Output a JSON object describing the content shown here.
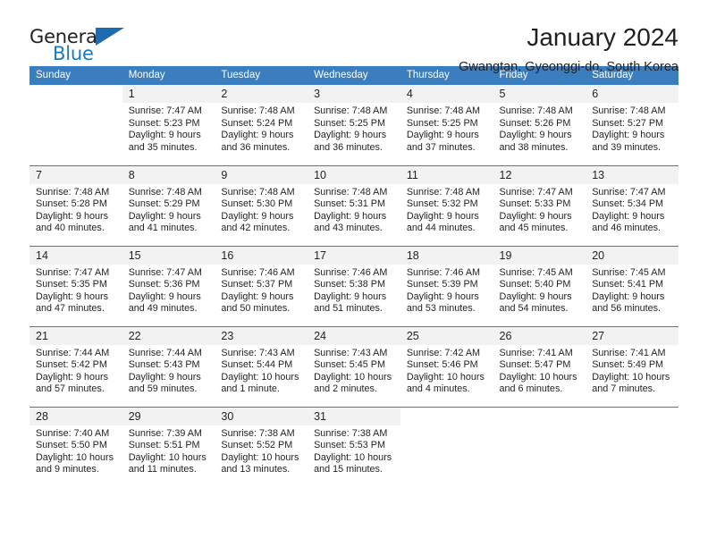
{
  "brand": {
    "name_part1": "General",
    "name_part2": "Blue",
    "logo_icon": "triangle-logo-icon",
    "accent_color": "#1b6cb0"
  },
  "header": {
    "title": "January 2024",
    "subtitle": "Gwangtan, Gyeonggi-do, South Korea"
  },
  "calendar": {
    "header_background": "#3a7ebf",
    "daynum_background": "#f2f2f2",
    "weekday_headers": [
      "Sunday",
      "Monday",
      "Tuesday",
      "Wednesday",
      "Thursday",
      "Friday",
      "Saturday"
    ],
    "weeks": [
      [
        {
          "day": "",
          "sunrise": "",
          "sunset": "",
          "daylight_line1": "",
          "daylight_line2": "",
          "blank": true
        },
        {
          "day": "1",
          "sunrise": "Sunrise: 7:47 AM",
          "sunset": "Sunset: 5:23 PM",
          "daylight_line1": "Daylight: 9 hours",
          "daylight_line2": "and 35 minutes."
        },
        {
          "day": "2",
          "sunrise": "Sunrise: 7:48 AM",
          "sunset": "Sunset: 5:24 PM",
          "daylight_line1": "Daylight: 9 hours",
          "daylight_line2": "and 36 minutes."
        },
        {
          "day": "3",
          "sunrise": "Sunrise: 7:48 AM",
          "sunset": "Sunset: 5:25 PM",
          "daylight_line1": "Daylight: 9 hours",
          "daylight_line2": "and 36 minutes."
        },
        {
          "day": "4",
          "sunrise": "Sunrise: 7:48 AM",
          "sunset": "Sunset: 5:25 PM",
          "daylight_line1": "Daylight: 9 hours",
          "daylight_line2": "and 37 minutes."
        },
        {
          "day": "5",
          "sunrise": "Sunrise: 7:48 AM",
          "sunset": "Sunset: 5:26 PM",
          "daylight_line1": "Daylight: 9 hours",
          "daylight_line2": "and 38 minutes."
        },
        {
          "day": "6",
          "sunrise": "Sunrise: 7:48 AM",
          "sunset": "Sunset: 5:27 PM",
          "daylight_line1": "Daylight: 9 hours",
          "daylight_line2": "and 39 minutes."
        }
      ],
      [
        {
          "day": "7",
          "sunrise": "Sunrise: 7:48 AM",
          "sunset": "Sunset: 5:28 PM",
          "daylight_line1": "Daylight: 9 hours",
          "daylight_line2": "and 40 minutes."
        },
        {
          "day": "8",
          "sunrise": "Sunrise: 7:48 AM",
          "sunset": "Sunset: 5:29 PM",
          "daylight_line1": "Daylight: 9 hours",
          "daylight_line2": "and 41 minutes."
        },
        {
          "day": "9",
          "sunrise": "Sunrise: 7:48 AM",
          "sunset": "Sunset: 5:30 PM",
          "daylight_line1": "Daylight: 9 hours",
          "daylight_line2": "and 42 minutes."
        },
        {
          "day": "10",
          "sunrise": "Sunrise: 7:48 AM",
          "sunset": "Sunset: 5:31 PM",
          "daylight_line1": "Daylight: 9 hours",
          "daylight_line2": "and 43 minutes."
        },
        {
          "day": "11",
          "sunrise": "Sunrise: 7:48 AM",
          "sunset": "Sunset: 5:32 PM",
          "daylight_line1": "Daylight: 9 hours",
          "daylight_line2": "and 44 minutes."
        },
        {
          "day": "12",
          "sunrise": "Sunrise: 7:47 AM",
          "sunset": "Sunset: 5:33 PM",
          "daylight_line1": "Daylight: 9 hours",
          "daylight_line2": "and 45 minutes."
        },
        {
          "day": "13",
          "sunrise": "Sunrise: 7:47 AM",
          "sunset": "Sunset: 5:34 PM",
          "daylight_line1": "Daylight: 9 hours",
          "daylight_line2": "and 46 minutes."
        }
      ],
      [
        {
          "day": "14",
          "sunrise": "Sunrise: 7:47 AM",
          "sunset": "Sunset: 5:35 PM",
          "daylight_line1": "Daylight: 9 hours",
          "daylight_line2": "and 47 minutes."
        },
        {
          "day": "15",
          "sunrise": "Sunrise: 7:47 AM",
          "sunset": "Sunset: 5:36 PM",
          "daylight_line1": "Daylight: 9 hours",
          "daylight_line2": "and 49 minutes."
        },
        {
          "day": "16",
          "sunrise": "Sunrise: 7:46 AM",
          "sunset": "Sunset: 5:37 PM",
          "daylight_line1": "Daylight: 9 hours",
          "daylight_line2": "and 50 minutes."
        },
        {
          "day": "17",
          "sunrise": "Sunrise: 7:46 AM",
          "sunset": "Sunset: 5:38 PM",
          "daylight_line1": "Daylight: 9 hours",
          "daylight_line2": "and 51 minutes."
        },
        {
          "day": "18",
          "sunrise": "Sunrise: 7:46 AM",
          "sunset": "Sunset: 5:39 PM",
          "daylight_line1": "Daylight: 9 hours",
          "daylight_line2": "and 53 minutes."
        },
        {
          "day": "19",
          "sunrise": "Sunrise: 7:45 AM",
          "sunset": "Sunset: 5:40 PM",
          "daylight_line1": "Daylight: 9 hours",
          "daylight_line2": "and 54 minutes."
        },
        {
          "day": "20",
          "sunrise": "Sunrise: 7:45 AM",
          "sunset": "Sunset: 5:41 PM",
          "daylight_line1": "Daylight: 9 hours",
          "daylight_line2": "and 56 minutes."
        }
      ],
      [
        {
          "day": "21",
          "sunrise": "Sunrise: 7:44 AM",
          "sunset": "Sunset: 5:42 PM",
          "daylight_line1": "Daylight: 9 hours",
          "daylight_line2": "and 57 minutes."
        },
        {
          "day": "22",
          "sunrise": "Sunrise: 7:44 AM",
          "sunset": "Sunset: 5:43 PM",
          "daylight_line1": "Daylight: 9 hours",
          "daylight_line2": "and 59 minutes."
        },
        {
          "day": "23",
          "sunrise": "Sunrise: 7:43 AM",
          "sunset": "Sunset: 5:44 PM",
          "daylight_line1": "Daylight: 10 hours",
          "daylight_line2": "and 1 minute."
        },
        {
          "day": "24",
          "sunrise": "Sunrise: 7:43 AM",
          "sunset": "Sunset: 5:45 PM",
          "daylight_line1": "Daylight: 10 hours",
          "daylight_line2": "and 2 minutes."
        },
        {
          "day": "25",
          "sunrise": "Sunrise: 7:42 AM",
          "sunset": "Sunset: 5:46 PM",
          "daylight_line1": "Daylight: 10 hours",
          "daylight_line2": "and 4 minutes."
        },
        {
          "day": "26",
          "sunrise": "Sunrise: 7:41 AM",
          "sunset": "Sunset: 5:47 PM",
          "daylight_line1": "Daylight: 10 hours",
          "daylight_line2": "and 6 minutes."
        },
        {
          "day": "27",
          "sunrise": "Sunrise: 7:41 AM",
          "sunset": "Sunset: 5:49 PM",
          "daylight_line1": "Daylight: 10 hours",
          "daylight_line2": "and 7 minutes."
        }
      ],
      [
        {
          "day": "28",
          "sunrise": "Sunrise: 7:40 AM",
          "sunset": "Sunset: 5:50 PM",
          "daylight_line1": "Daylight: 10 hours",
          "daylight_line2": "and 9 minutes."
        },
        {
          "day": "29",
          "sunrise": "Sunrise: 7:39 AM",
          "sunset": "Sunset: 5:51 PM",
          "daylight_line1": "Daylight: 10 hours",
          "daylight_line2": "and 11 minutes."
        },
        {
          "day": "30",
          "sunrise": "Sunrise: 7:38 AM",
          "sunset": "Sunset: 5:52 PM",
          "daylight_line1": "Daylight: 10 hours",
          "daylight_line2": "and 13 minutes."
        },
        {
          "day": "31",
          "sunrise": "Sunrise: 7:38 AM",
          "sunset": "Sunset: 5:53 PM",
          "daylight_line1": "Daylight: 10 hours",
          "daylight_line2": "and 15 minutes."
        },
        {
          "day": "",
          "sunrise": "",
          "sunset": "",
          "daylight_line1": "",
          "daylight_line2": "",
          "blank": true
        },
        {
          "day": "",
          "sunrise": "",
          "sunset": "",
          "daylight_line1": "",
          "daylight_line2": "",
          "blank": true
        },
        {
          "day": "",
          "sunrise": "",
          "sunset": "",
          "daylight_line1": "",
          "daylight_line2": "",
          "blank": true
        }
      ]
    ]
  }
}
